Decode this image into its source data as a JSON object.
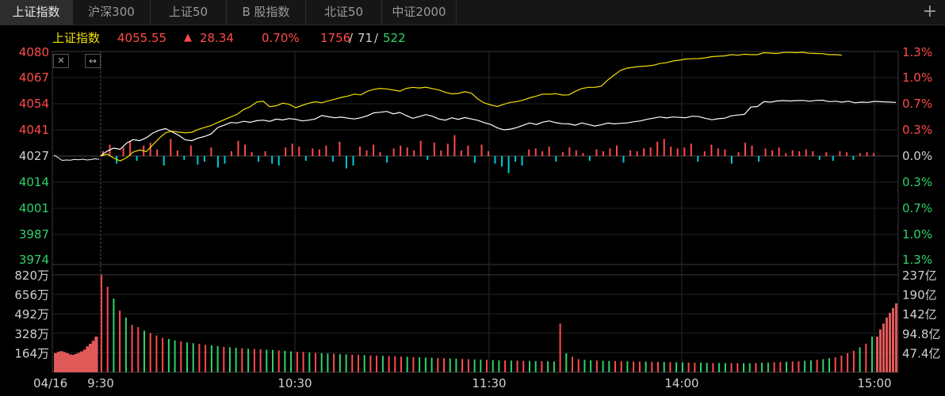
{
  "tabs": [
    {
      "label": "上证指数",
      "active": true
    },
    {
      "label": "沪深300",
      "active": false
    },
    {
      "label": "上证50",
      "active": false
    },
    {
      "label": "B 股指数",
      "active": false
    },
    {
      "label": "北证50",
      "active": false
    },
    {
      "label": "中证2000",
      "active": false
    }
  ],
  "add_tab_symbol": "+",
  "info": {
    "name": "上证指数",
    "price": "4055.55",
    "arrow": "▲",
    "change": "28.34",
    "change_pct": "0.70%",
    "up": "1756",
    "flat": "71",
    "down": "522",
    "sep": "/"
  },
  "toolbar": {
    "close_symbol": "✕",
    "expand_symbol": "↔"
  },
  "colors": {
    "up": "#ff4a4a",
    "down": "#2fd16a",
    "flat": "#d0d0d0",
    "index_line": "#ffffff",
    "avg_line": "#f0e000",
    "cyan": "#00c8d8",
    "grid": "#2c2c2c"
  },
  "chart_data": [
    {
      "type": "line",
      "name": "price",
      "x_ticks": [
        "04/16",
        "9:30",
        "10:30",
        "11:30",
        "14:00",
        "15:00"
      ],
      "y_left_ticks": [
        "4080",
        "4067",
        "4054",
        "4041",
        "4027",
        "4014",
        "4001",
        "3987",
        "3974"
      ],
      "y_right_ticks": [
        "1.3%",
        "1.0%",
        "0.7%",
        "0.3%",
        "0.0%",
        "0.3%",
        "0.7%",
        "1.0%",
        "1.3%"
      ],
      "ylim": [
        3974,
        4080
      ],
      "prev_close": 4027,
      "pre_session_index": [
        4027.5,
        4026.2,
        4024.8,
        4025.0,
        4024.9,
        4025.3,
        4025.1,
        4025.4,
        4025.0,
        4025.2,
        4025.6,
        4025.3
      ],
      "series": [
        {
          "values": [
            4027.2,
            4029.5,
            4031.0,
            4030.4,
            4033.6,
            4035.3,
            4034.8,
            4036.2,
            4038.6,
            4040.1,
            4040.9,
            4039.2,
            4037.5,
            4035.2,
            4034.8,
            4036.1,
            4036.9,
            4038.2,
            4041.4,
            4042.6,
            4044.0,
            4043.8,
            4044.6,
            4044.1,
            4044.9,
            4045.2,
            4044.6,
            4045.7,
            4045.3,
            4046.0,
            4045.6,
            4044.8,
            4045.2,
            4045.8,
            4047.5,
            4046.9,
            4046.4,
            4046.7,
            4046.2,
            4045.8,
            4046.4,
            4047.4,
            4048.9,
            4049.2,
            4049.6,
            4048.4,
            4049.1,
            4047.5,
            4046.1,
            4047.0,
            4048.0,
            4047.2,
            4045.8,
            4045.2,
            4046.4,
            4045.6,
            4046.5,
            4045.8,
            4045.1,
            4043.9,
            4043.0,
            4041.3,
            4040.3,
            4040.6,
            4041.4,
            4042.6,
            4043.8,
            4043.0,
            4044.2,
            4044.8,
            4043.9,
            4043.4,
            4043.3,
            4042.6,
            4043.8,
            4043.0,
            4042.2,
            4042.8,
            4043.7,
            4043.3,
            4043.6,
            4043.8,
            4044.4,
            4044.8,
            4045.6,
            4046.2,
            4046.8,
            4046.3,
            4046.8,
            4046.6,
            4046.4,
            4047.2,
            4047.0,
            4046.1,
            4045.4,
            4045.9,
            4046.2,
            4047.4,
            4047.8,
            4048.1,
            4051.8,
            4052.1,
            4054.6,
            4054.3,
            4054.9,
            4055.1,
            4054.9,
            4055.1,
            4055.2,
            4054.8,
            4055.2,
            4055.3,
            4054.6,
            4054.8,
            4054.3,
            4054.8,
            4054.0,
            4054.3,
            4054.2,
            4054.7
          ]
        },
        {
          "values": [
            4027.0,
            4028.0,
            4026.0,
            4024.5,
            4026.2,
            4029.0,
            4030.1,
            4029.2,
            4032.6,
            4036.0,
            4038.8,
            4039.6,
            4039.1,
            4038.8,
            4039.0,
            4040.5,
            4041.5,
            4042.5,
            4044.0,
            4045.4,
            4046.8,
            4048.1,
            4050.6,
            4052.0,
            4054.4,
            4054.8,
            4052.0,
            4052.5,
            4053.8,
            4053.2,
            4051.5,
            4052.7,
            4053.8,
            4054.5,
            4054.0,
            4055.0,
            4055.8,
            4056.7,
            4057.4,
            4058.4,
            4058.0,
            4059.8,
            4060.8,
            4061.3,
            4061.0,
            4060.5,
            4059.9,
            4061.3,
            4061.8,
            4061.5,
            4061.9,
            4061.2,
            4060.5,
            4059.3,
            4058.5,
            4058.7,
            4059.6,
            4058.9,
            4055.9,
            4053.9,
            4052.9,
            4052.1,
            4053.2,
            4054.2,
            4054.6,
            4055.4,
            4056.5,
            4057.4,
            4058.4,
            4058.3,
            4058.6,
            4057.9,
            4058.0,
            4059.8,
            4061.2,
            4061.8,
            4061.8,
            4062.4,
            4065.6,
            4068.1,
            4070.5,
            4071.6,
            4072.0,
            4072.4,
            4072.6,
            4073.0,
            4073.9,
            4074.3,
            4075.2,
            4075.6,
            4076.2,
            4076.3,
            4076.4,
            4076.8,
            4077.4,
            4077.6,
            4077.8,
            4078.4,
            4078.1,
            4078.6,
            4078.4,
            4078.4,
            4079.4,
            4079.2,
            4079.0,
            4079.5,
            4079.5,
            4079.4,
            4079.6,
            4079.1,
            4079.0,
            4078.9,
            4078.4,
            4078.4,
            4078.1
          ]
        }
      ],
      "momentum": [
        0.5,
        1.2,
        -0.8,
        0.9,
        1.6,
        -0.5,
        1.1,
        1.4,
        0.7,
        -1.0,
        1.8,
        0.6,
        -0.4,
        1.1,
        -0.9,
        -0.6,
        0.9,
        -1.2,
        -0.8,
        0.5,
        1.6,
        1.2,
        0.4,
        -0.6,
        0.5,
        -0.8,
        -1.0,
        0.9,
        1.3,
        1.0,
        -0.5,
        0.8,
        0.7,
        1.1,
        -0.6,
        1.5,
        -1.3,
        -1.0,
        1.0,
        0.6,
        1.2,
        0.4,
        -0.7,
        0.8,
        1.1,
        0.9,
        0.6,
        1.6,
        -0.4,
        1.4,
        0.6,
        1.3,
        2.2,
        0.6,
        1.1,
        -0.7,
        1.2,
        0.5,
        -0.8,
        -1.1,
        -1.8,
        -0.6,
        -1.0,
        0.7,
        0.8,
        0.5,
        1.0,
        -0.6,
        0.4,
        0.9,
        0.6,
        0.3,
        -0.5,
        0.7,
        0.5,
        0.8,
        1.1,
        -0.7,
        0.6,
        0.5,
        0.8,
        0.9,
        1.5,
        1.8,
        1.0,
        0.8,
        0.9,
        1.3,
        -0.6,
        0.5,
        1.2,
        0.8,
        0.7,
        -0.8,
        0.4,
        1.4,
        1.1,
        -0.6,
        0.8,
        0.6,
        0.9,
        0.3,
        0.6,
        0.5,
        0.7,
        0.5,
        -0.4,
        0.4,
        -0.5,
        0.5,
        0.4,
        -0.4,
        0.3,
        0.4,
        0.3
      ]
    },
    {
      "type": "bar",
      "name": "volume",
      "y_left_ticks": [
        "820万",
        "656万",
        "492万",
        "328万",
        "164万"
      ],
      "y_right_ticks": [
        "237亿",
        "190亿",
        "142亿",
        "94.8亿",
        "47.4亿"
      ],
      "ylim": [
        0,
        820
      ],
      "unit": "万",
      "pre_session": [
        160,
        172,
        178,
        171,
        160,
        150,
        146,
        154,
        164,
        176,
        190,
        218,
        240,
        265,
        300
      ],
      "values": [
        820,
        720,
        620,
        520,
        460,
        400,
        380,
        350,
        330,
        310,
        290,
        280,
        268,
        260,
        250,
        245,
        238,
        230,
        226,
        220,
        214,
        210,
        206,
        202,
        198,
        196,
        194,
        190,
        187,
        184,
        180,
        176,
        172,
        170,
        166,
        163,
        160,
        158,
        156,
        153,
        150,
        148,
        146,
        144,
        142,
        140,
        138,
        136,
        134,
        132,
        130,
        128,
        126,
        124,
        122,
        120,
        118,
        116,
        114,
        112,
        110,
        108,
        106,
        104,
        102,
        100,
        99,
        98,
        97,
        96,
        95,
        94,
        93,
        92,
        91,
        410,
        160,
        130,
        110,
        105,
        100,
        98,
        96,
        95,
        94,
        93,
        92,
        91,
        90,
        89,
        88,
        87,
        86,
        85,
        84,
        83,
        82,
        81,
        80,
        79,
        78,
        78,
        77,
        77,
        76,
        76,
        76,
        78,
        80,
        82,
        84,
        86,
        88,
        90,
        92,
        96,
        100,
        104,
        110,
        118,
        126,
        140,
        160,
        180,
        210,
        240,
        300
      ],
      "directions": "uududuuduuuddudduuddudduduuddudduududdudduuduuduuududdduudduuddudduduuddudduduuddudduuduuduududduuddudduuddudduuduuddudduu",
      "closing_auction": [
        300,
        360,
        410,
        460,
        500,
        540,
        580
      ]
    }
  ]
}
